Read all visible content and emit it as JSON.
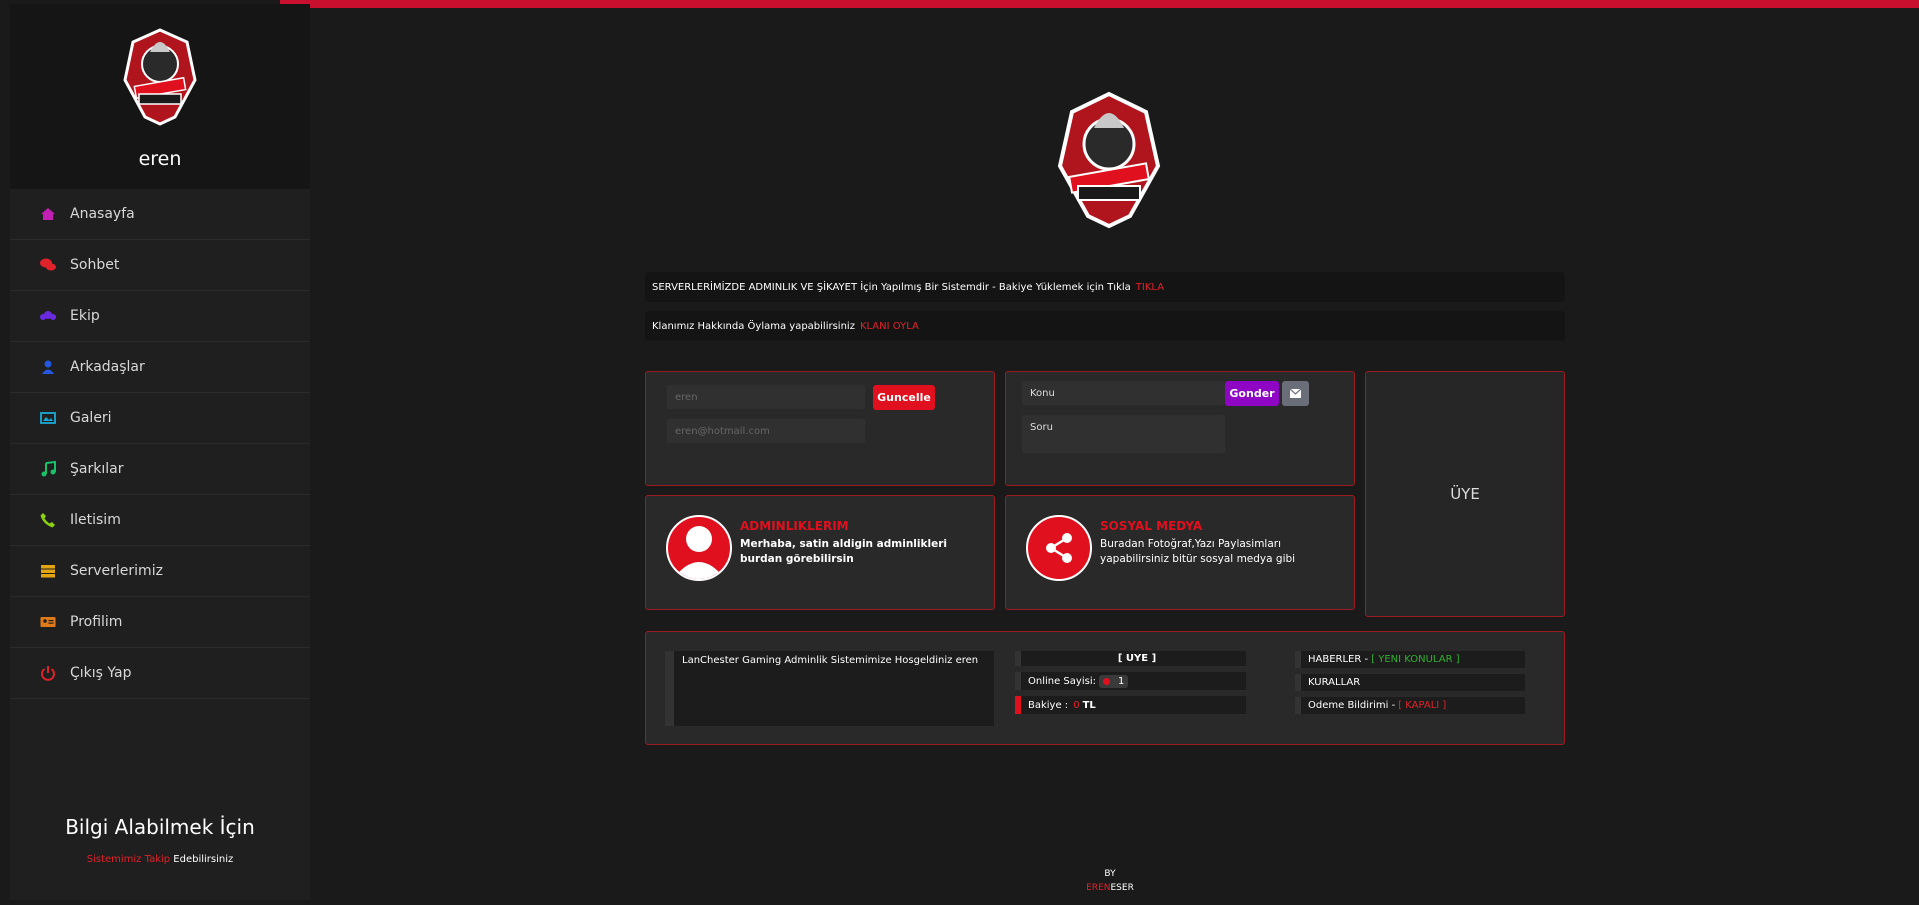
{
  "sidebar": {
    "username": "eren",
    "items": [
      {
        "label": "Anasayfa",
        "icon": "home-icon",
        "color": "#c21fb3"
      },
      {
        "label": "Sohbet",
        "icon": "chat-icon",
        "color": "#e0222a"
      },
      {
        "label": "Ekip",
        "icon": "group-icon",
        "color": "#6a2be0"
      },
      {
        "label": "Arkadaşlar",
        "icon": "user-icon",
        "color": "#2458e0"
      },
      {
        "label": "Galeri",
        "icon": "image-icon",
        "color": "#1aa9d6"
      },
      {
        "label": "Şarkılar",
        "icon": "music-icon",
        "color": "#18c06a"
      },
      {
        "label": "Iletisim",
        "icon": "phone-icon",
        "color": "#8cd10e"
      },
      {
        "label": "Serverlerimiz",
        "icon": "server-icon",
        "color": "#e2a410"
      },
      {
        "label": "Profilim",
        "icon": "id-card-icon",
        "color": "#e07a18"
      },
      {
        "label": "Çıkış Yap",
        "icon": "power-icon",
        "color": "#e0222a"
      }
    ],
    "footer_title": "Bilgi Alabilmek İçin",
    "footer_sub_red": "Sistemimiz Takip",
    "footer_sub_white": "Edebilirsiniz"
  },
  "banner1": {
    "text": "SERVERLERİMİZDE ADMINLIK VE ŞİKAYET İçin Yapılmış Bir Sistemdir - Bakiye Yüklemek için Tıkla",
    "link": "TIKLA"
  },
  "banner2": {
    "text": "Klanımız Hakkında Öylama yapabilirsiniz",
    "link": "KLANI OYLA"
  },
  "profile_form": {
    "name_placeholder": "eren",
    "email_placeholder": "eren@hotmail.com",
    "update_button": "Guncelle"
  },
  "message_form": {
    "subject_placeholder": "Konu",
    "question_placeholder": "Soru",
    "send_button": "Gonder"
  },
  "uye_label": "ÜYE",
  "admin_card": {
    "title": "ADMINLIKLERIM",
    "text": "Merhaba, satin aldigin adminlikleri burdan görebilirsin"
  },
  "social_card": {
    "title": "SOSYAL MEDYA",
    "text": "Buradan Fotoğraf,Yazı Paylasimları yapabilirsiniz bitür sosyal medya gibi"
  },
  "bottom": {
    "welcome": "LanChester Gaming Adminlik Sistemimize Hosgeldiniz eren",
    "role": "[ UYE ]",
    "online_label": "Online Sayisi:",
    "online_count": "1",
    "balance_label": "Bakiye :",
    "balance_value": "0",
    "balance_unit": "TL",
    "news_label": "HABERLER -",
    "news_link": "[ YENI KONULAR ]",
    "rules": "KURALLAR",
    "payment_label": "Odeme Bildirimi -",
    "payment_status": "[ KAPALI ]"
  },
  "footer": {
    "by": "BY",
    "author_red": "EREN",
    "author_white": "ESER"
  },
  "colors": {
    "accent": "#e0101e",
    "purple": "#8e06c4",
    "green": "#30b030"
  }
}
